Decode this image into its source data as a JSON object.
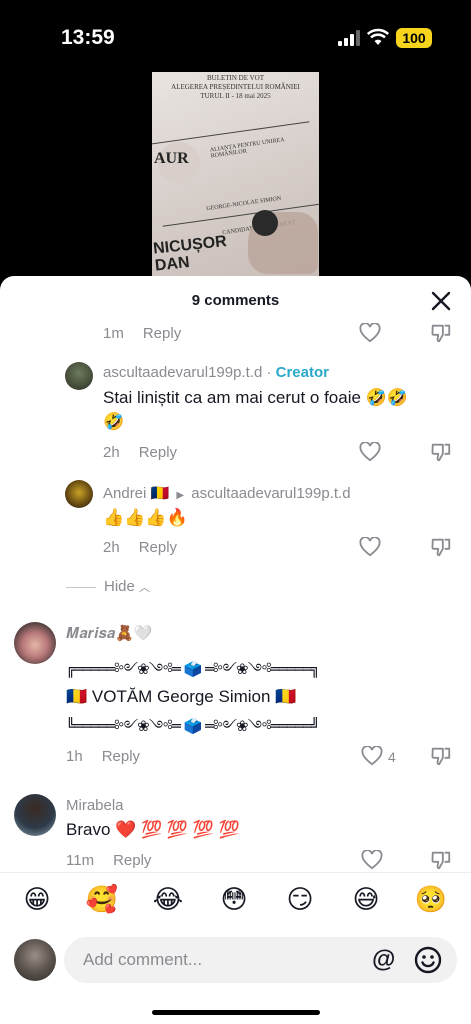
{
  "status_bar": {
    "time": "13:59",
    "battery": "100"
  },
  "video_preview": {
    "ballot_header": "BULETIN DE VOT\nALEGEREA PREȘEDINTELUI ROMÂNIEI\nTURUL II - 18 mai 2025",
    "party_logo": "AUR",
    "party_name": "ALIANȚA PENTRU UNIREA ROMÂNILOR",
    "candidate_1": "GEORGE-NICOLAE SIMION",
    "candidate_2_label": "CANDIDAT INDEPENDENT",
    "candidate_2": "NICUȘOR DAN"
  },
  "sheet": {
    "title": "9 comments",
    "close_icon": "close-icon"
  },
  "comments": [
    {
      "time": "1m",
      "reply_label": "Reply"
    },
    {
      "username": "ascultaadevarul199p.t.d",
      "separator": "·",
      "badge": "Creator",
      "text_line1": "Stai liniștit ca am mai cerut o foaie 🤣🤣",
      "text_line2": "🤣",
      "time": "2h",
      "reply_label": "Reply"
    },
    {
      "username": "Andrei 🇹🇩",
      "reply_to": "ascultaadevarul199p.t.d",
      "text": "👍👍👍🔥",
      "time": "2h",
      "reply_label": "Reply"
    },
    {
      "hide_label": "Hide"
    },
    {
      "username": "𝑴𝒂𝒓𝒊𝒔𝒂🧸🤍",
      "deco_top": "╔═════༻❀༺═ 🗳️ ═༻❀༺═════╗",
      "text": "🇷🇴 VOTĂM George Simion 🇷🇴",
      "deco_bottom": "╚═════༻❀༺═ 🗳️ ═༻❀༺═════╝",
      "time": "1h",
      "reply_label": "Reply",
      "likes": "4"
    },
    {
      "username": "Mirabela",
      "text": "Bravo ❤️ 💯 💯 💯 💯",
      "time": "11m",
      "reply_label": "Reply"
    }
  ],
  "emoji_bar": [
    "😁",
    "🥰",
    "😂",
    "😳",
    "😏",
    "😅",
    "🥺"
  ],
  "input": {
    "placeholder": "Add comment...",
    "at_label": "@"
  },
  "colors": {
    "creator": "#2aa9c9",
    "muted": "#8a8b91",
    "battery": "#f7d51d"
  }
}
